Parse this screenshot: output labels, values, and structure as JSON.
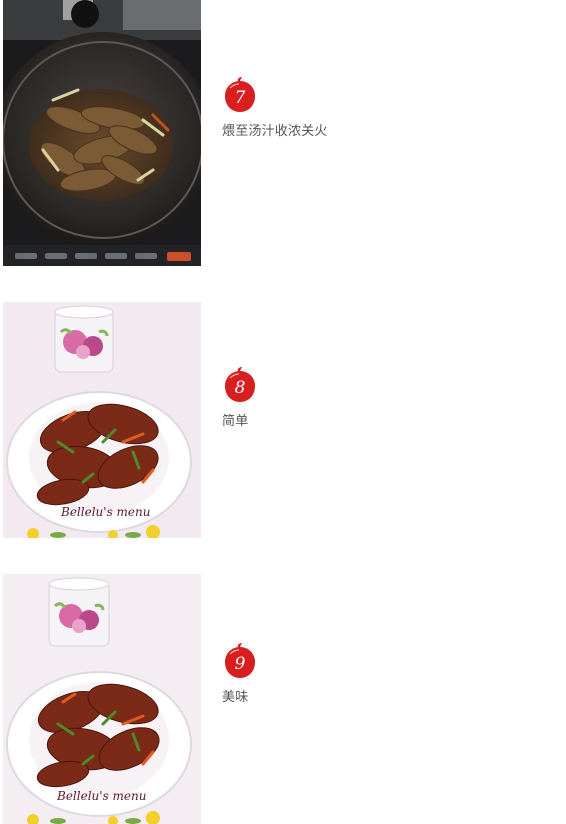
{
  "colors": {
    "badge_red": "#d81e1e",
    "text_gray": "#555555"
  },
  "steps": [
    {
      "number": "7",
      "text": "煨至汤汁收浓关火",
      "photo": "wok-fish-cooking-photo"
    },
    {
      "number": "8",
      "text": "简单",
      "photo": "plated-fish-dish-photo",
      "watermark": "Bellelu's menu"
    },
    {
      "number": "9",
      "text": "美味",
      "photo": "plated-fish-dish-photo",
      "watermark": "Bellelu's menu"
    }
  ]
}
